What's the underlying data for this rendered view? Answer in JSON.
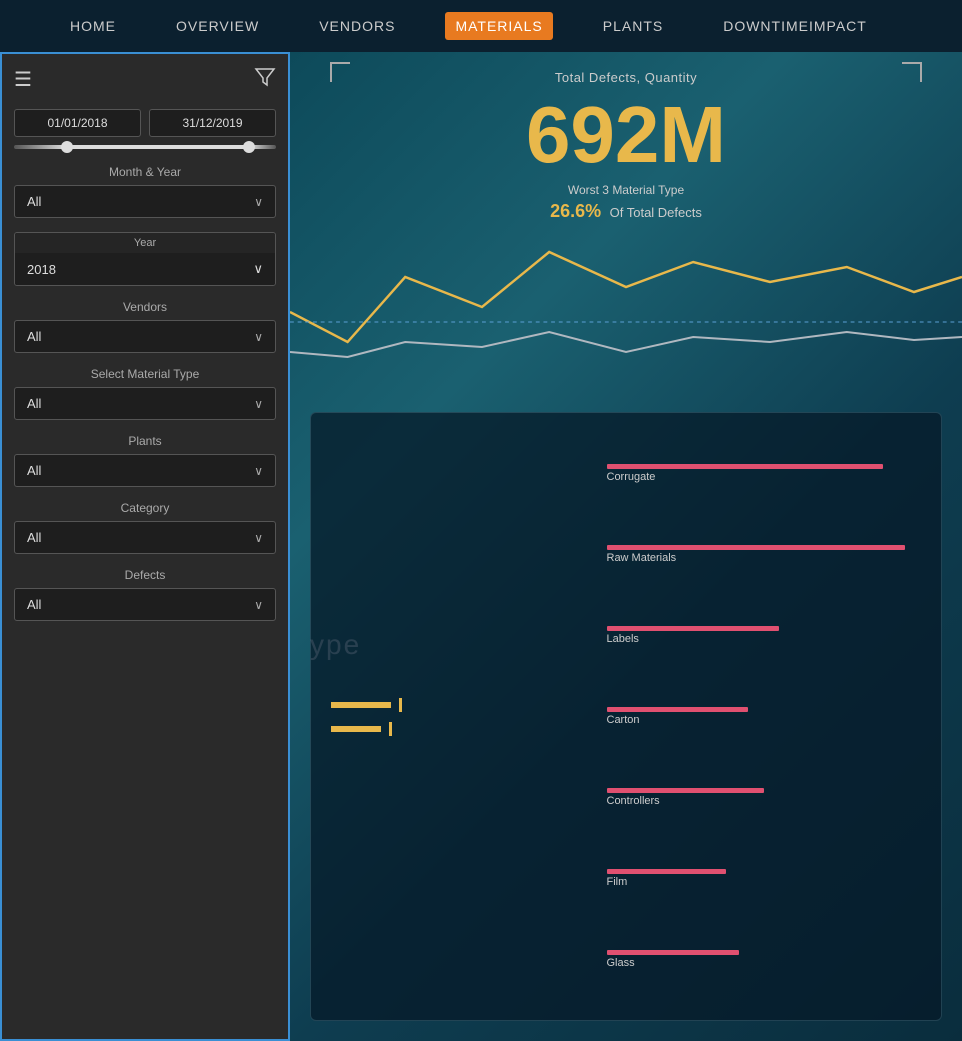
{
  "navbar": {
    "items": [
      {
        "id": "home",
        "label": "Home",
        "active": false
      },
      {
        "id": "overview",
        "label": "Overview",
        "active": false
      },
      {
        "id": "vendors",
        "label": "Vendors",
        "active": false
      },
      {
        "id": "materials",
        "label": "Materials",
        "active": true
      },
      {
        "id": "plants",
        "label": "Plants",
        "active": false
      },
      {
        "id": "downtime-impact",
        "label": "DowntimeImpact",
        "active": false
      }
    ]
  },
  "chart": {
    "title": "Total Defects, Quantity",
    "big_number": "692M",
    "subtitle": "Worst 3 Material Type",
    "percent": "26.6%",
    "percent_label": "Of Total Defects"
  },
  "bottom_bars": {
    "right_items": [
      {
        "label": "Corrugate",
        "width": 88
      },
      {
        "label": "Raw Materials",
        "width": 95
      },
      {
        "label": "Labels",
        "width": 55
      },
      {
        "label": "Carton",
        "width": 45
      },
      {
        "label": "Controllers",
        "width": 50
      },
      {
        "label": "Film",
        "width": 38
      },
      {
        "label": "Glass",
        "width": 42
      }
    ]
  },
  "sidebar": {
    "date_start": "01/01/2018",
    "date_end": "31/12/2019",
    "month_year_label": "Month & Year",
    "month_year_value": "All",
    "year_label": "Year",
    "year_value": "2018",
    "vendors_label": "Vendors",
    "vendors_value": "All",
    "material_type_label": "Select Material Type",
    "material_type_value": "All",
    "plants_label": "Plants",
    "plants_value": "All",
    "category_label": "Category",
    "category_value": "All",
    "defects_label": "Defects",
    "defects_value": "All"
  },
  "type_text": "ype",
  "icons": {
    "hamburger": "☰",
    "filter": "⧖",
    "chevron": "∨",
    "windows": "⊞"
  },
  "colors": {
    "accent_orange": "#e87a20",
    "accent_yellow": "#e8b84b",
    "sidebar_border": "#3a8fd4",
    "sidebar_bg": "#2a2a2a",
    "nav_bg": "#0d1e2c",
    "pink_bar": "#e05070"
  }
}
